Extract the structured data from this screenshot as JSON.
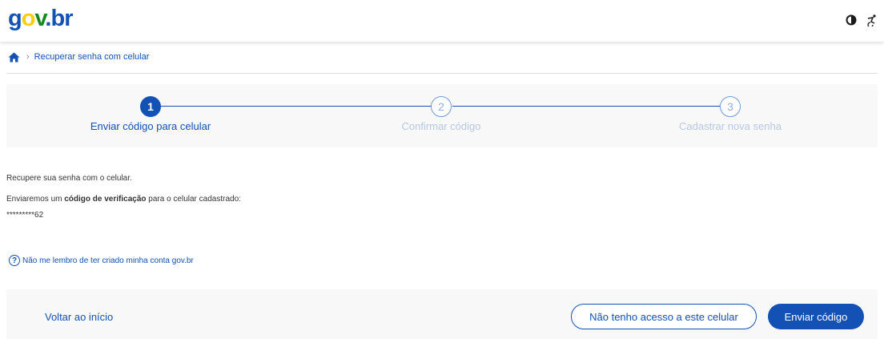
{
  "header": {
    "logo": {
      "g": "g",
      "o": "o",
      "v": "v",
      "dot": ".",
      "br": "br"
    },
    "icons": [
      "contrast-icon",
      "accessibility-icon"
    ]
  },
  "breadcrumb": {
    "home_icon": "home-icon",
    "separator": "›",
    "current": "Recuperar senha com celular"
  },
  "stepper": {
    "steps": [
      {
        "number": "1",
        "label": "Enviar código para celular",
        "state": "active"
      },
      {
        "number": "2",
        "label": "Confirmar código",
        "state": "inactive"
      },
      {
        "number": "3",
        "label": "Cadastrar nova senha",
        "state": "inactive"
      }
    ]
  },
  "content": {
    "intro": "Recupere sua senha com o celular.",
    "sent_prefix": "Enviaremos um ",
    "sent_bold": "código de verificação",
    "sent_suffix": " para o celular cadastrado:",
    "masked_phone": "*********62",
    "help_icon": "?",
    "help_link": "Não me lembro de ter criado minha conta gov.br"
  },
  "actions": {
    "back_label": "Voltar ao início",
    "no_access_label": "Não tenho acesso a este celular",
    "send_label": "Enviar código"
  },
  "colors": {
    "primary": "#1351b4",
    "logo_yellow": "#ffcd07",
    "logo_green": "#168821",
    "panel_bg": "#f8f8f8"
  }
}
